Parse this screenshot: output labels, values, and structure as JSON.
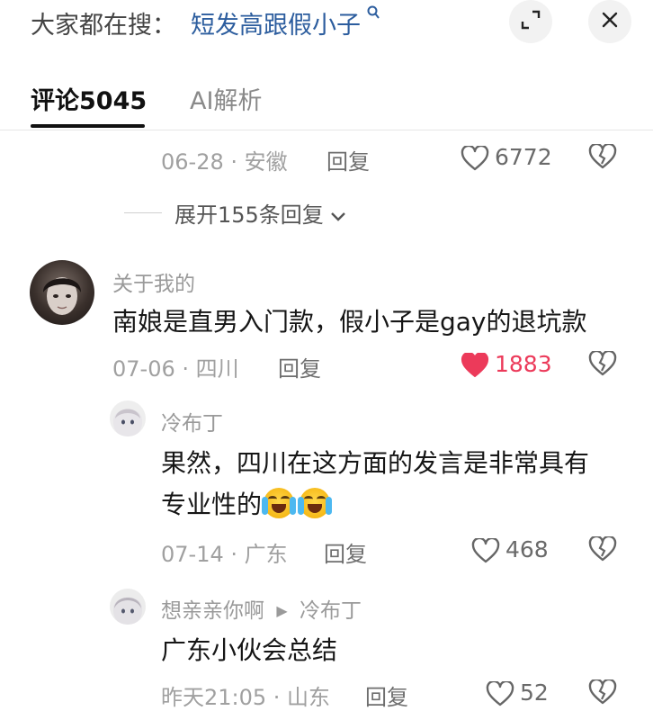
{
  "header": {
    "search_prefix": "大家都在搜：",
    "search_term": "短发高跟假小子",
    "search_icon": "search-icon",
    "expand_icon": "expand-icon",
    "close_icon": "close-icon"
  },
  "tabs": [
    {
      "label": "评论5045",
      "active": true
    },
    {
      "label": "AI解析",
      "active": false
    }
  ],
  "top_comment_tail": {
    "date_location": "06-28 · 安徽",
    "reply_label": "回复",
    "like_count": "6772",
    "expand_replies": "展开155条回复"
  },
  "comments": [
    {
      "username": "关于我的",
      "text": "南娘是直男入门款，假小子是gay的退坑款",
      "date_location": "07-06 · 四川",
      "reply_label": "回复",
      "like_count": "1883",
      "liked": true
    }
  ],
  "replies": [
    {
      "username": "冷布丁",
      "text_line1": "果然，四川在这方面的发言是非常具有",
      "text_line2": "专业性的",
      "emojis": [
        "crying-laughing-emoji",
        "crying-laughing-emoji"
      ],
      "date_location": "07-14 · 广东",
      "reply_label": "回复",
      "like_count": "468"
    },
    {
      "username": "想亲亲你啊",
      "reply_to": "冷布丁",
      "text": "广东小伙会总结",
      "date_location": "昨天21:05 · 山东",
      "reply_label": "回复",
      "like_count": "52"
    }
  ],
  "colors": {
    "link_blue": "#2c5d9e",
    "like_red": "#ec3a5a",
    "meta_gray": "#a0a0a0"
  }
}
